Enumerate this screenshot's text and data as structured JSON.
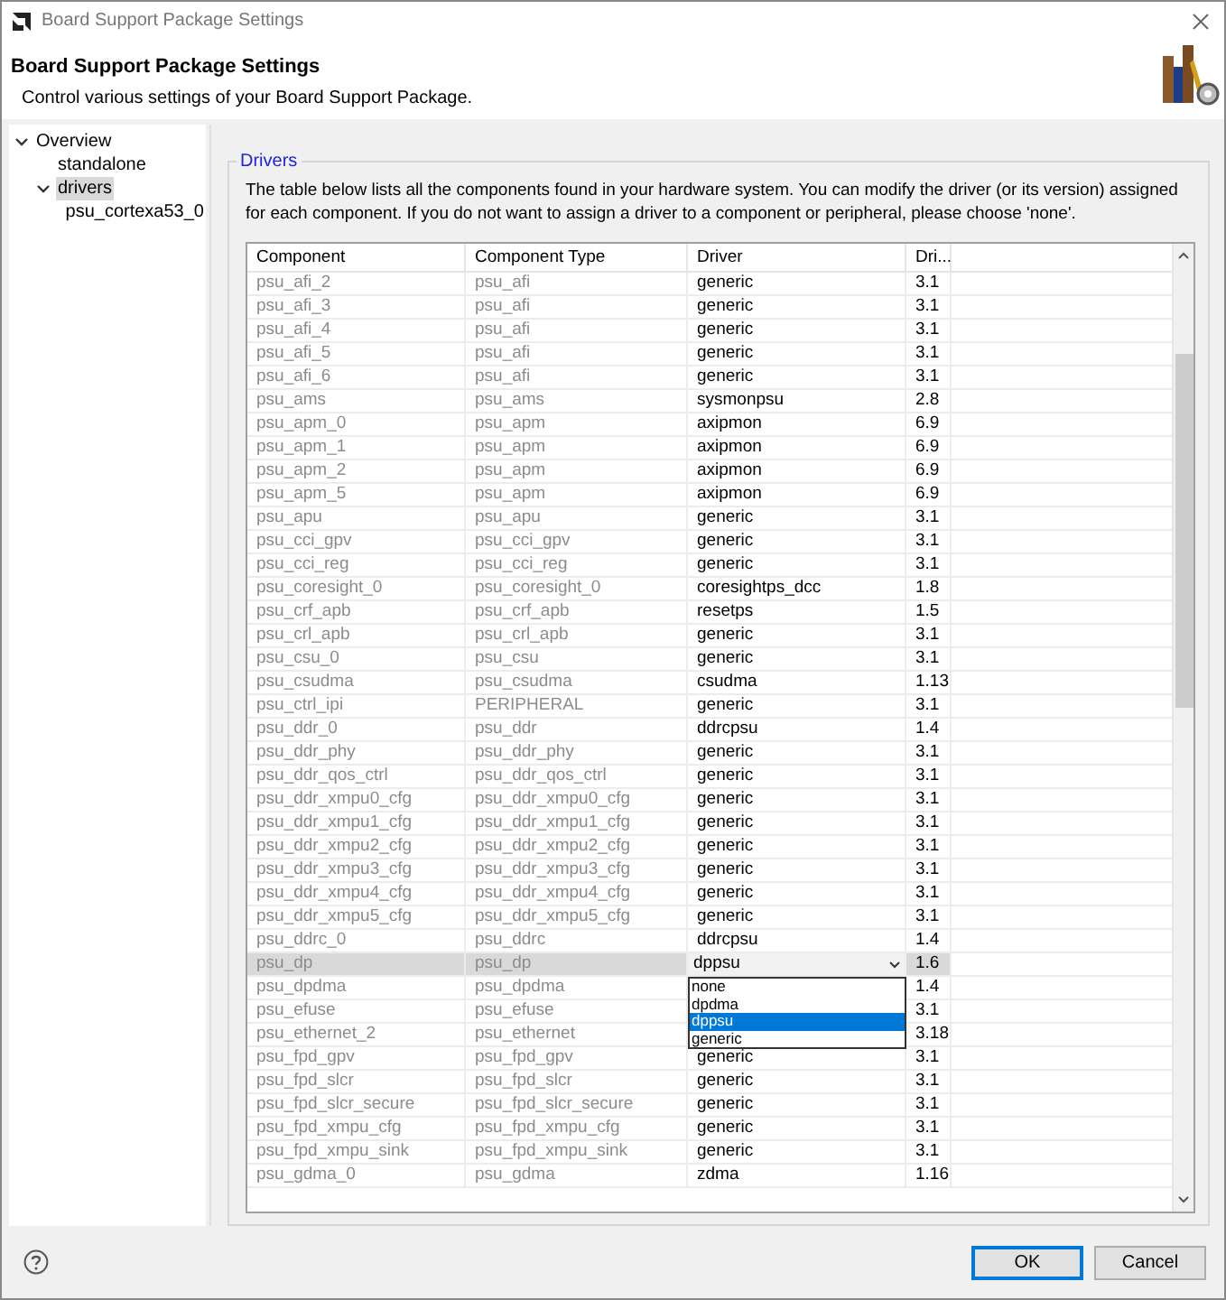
{
  "window": {
    "title": "Board Support Package Settings"
  },
  "header": {
    "title": "Board Support Package Settings",
    "subtitle": "Control various settings of your Board Support Package."
  },
  "tree": [
    {
      "label": "Overview",
      "expanded": true,
      "selected": false,
      "children": [
        {
          "label": "standalone",
          "selected": false
        },
        {
          "label": "drivers",
          "expanded": true,
          "selected": true,
          "children": [
            {
              "label": "psu_cortexa53_0",
              "selected": false
            }
          ]
        }
      ]
    }
  ],
  "group": {
    "title": "Drivers",
    "description": "The table below lists all the components found in your hardware system. You can modify the driver (or its version) assigned for each component. If you do not want to assign a driver to a component or peripheral, please choose 'none'."
  },
  "table": {
    "columns": [
      "Component",
      "Component Type",
      "Driver",
      "Dri..."
    ],
    "rows": [
      {
        "component": "psu_afi_2",
        "type": "psu_afi",
        "driver": "generic",
        "version": "3.1",
        "selected": false
      },
      {
        "component": "psu_afi_3",
        "type": "psu_afi",
        "driver": "generic",
        "version": "3.1",
        "selected": false
      },
      {
        "component": "psu_afi_4",
        "type": "psu_afi",
        "driver": "generic",
        "version": "3.1",
        "selected": false
      },
      {
        "component": "psu_afi_5",
        "type": "psu_afi",
        "driver": "generic",
        "version": "3.1",
        "selected": false
      },
      {
        "component": "psu_afi_6",
        "type": "psu_afi",
        "driver": "generic",
        "version": "3.1",
        "selected": false
      },
      {
        "component": "psu_ams",
        "type": "psu_ams",
        "driver": "sysmonpsu",
        "version": "2.8",
        "selected": false
      },
      {
        "component": "psu_apm_0",
        "type": "psu_apm",
        "driver": "axipmon",
        "version": "6.9",
        "selected": false
      },
      {
        "component": "psu_apm_1",
        "type": "psu_apm",
        "driver": "axipmon",
        "version": "6.9",
        "selected": false
      },
      {
        "component": "psu_apm_2",
        "type": "psu_apm",
        "driver": "axipmon",
        "version": "6.9",
        "selected": false
      },
      {
        "component": "psu_apm_5",
        "type": "psu_apm",
        "driver": "axipmon",
        "version": "6.9",
        "selected": false
      },
      {
        "component": "psu_apu",
        "type": "psu_apu",
        "driver": "generic",
        "version": "3.1",
        "selected": false
      },
      {
        "component": "psu_cci_gpv",
        "type": "psu_cci_gpv",
        "driver": "generic",
        "version": "3.1",
        "selected": false
      },
      {
        "component": "psu_cci_reg",
        "type": "psu_cci_reg",
        "driver": "generic",
        "version": "3.1",
        "selected": false
      },
      {
        "component": "psu_coresight_0",
        "type": "psu_coresight_0",
        "driver": "coresightps_dcc",
        "version": "1.8",
        "selected": false
      },
      {
        "component": "psu_crf_apb",
        "type": "psu_crf_apb",
        "driver": "resetps",
        "version": "1.5",
        "selected": false
      },
      {
        "component": "psu_crl_apb",
        "type": "psu_crl_apb",
        "driver": "generic",
        "version": "3.1",
        "selected": false
      },
      {
        "component": "psu_csu_0",
        "type": "psu_csu",
        "driver": "generic",
        "version": "3.1",
        "selected": false
      },
      {
        "component": "psu_csudma",
        "type": "psu_csudma",
        "driver": "csudma",
        "version": "1.13",
        "selected": false
      },
      {
        "component": "psu_ctrl_ipi",
        "type": "PERIPHERAL",
        "driver": "generic",
        "version": "3.1",
        "selected": false
      },
      {
        "component": "psu_ddr_0",
        "type": "psu_ddr",
        "driver": "ddrcpsu",
        "version": "1.4",
        "selected": false
      },
      {
        "component": "psu_ddr_phy",
        "type": "psu_ddr_phy",
        "driver": "generic",
        "version": "3.1",
        "selected": false
      },
      {
        "component": "psu_ddr_qos_ctrl",
        "type": "psu_ddr_qos_ctrl",
        "driver": "generic",
        "version": "3.1",
        "selected": false
      },
      {
        "component": "psu_ddr_xmpu0_cfg",
        "type": "psu_ddr_xmpu0_cfg",
        "driver": "generic",
        "version": "3.1",
        "selected": false
      },
      {
        "component": "psu_ddr_xmpu1_cfg",
        "type": "psu_ddr_xmpu1_cfg",
        "driver": "generic",
        "version": "3.1",
        "selected": false
      },
      {
        "component": "psu_ddr_xmpu2_cfg",
        "type": "psu_ddr_xmpu2_cfg",
        "driver": "generic",
        "version": "3.1",
        "selected": false
      },
      {
        "component": "psu_ddr_xmpu3_cfg",
        "type": "psu_ddr_xmpu3_cfg",
        "driver": "generic",
        "version": "3.1",
        "selected": false
      },
      {
        "component": "psu_ddr_xmpu4_cfg",
        "type": "psu_ddr_xmpu4_cfg",
        "driver": "generic",
        "version": "3.1",
        "selected": false
      },
      {
        "component": "psu_ddr_xmpu5_cfg",
        "type": "psu_ddr_xmpu5_cfg",
        "driver": "generic",
        "version": "3.1",
        "selected": false
      },
      {
        "component": "psu_ddrc_0",
        "type": "psu_ddrc",
        "driver": "ddrcpsu",
        "version": "1.4",
        "selected": false
      },
      {
        "component": "psu_dp",
        "type": "psu_dp",
        "driver": "dppsu",
        "version": "1.6",
        "selected": true,
        "dropdown": [
          {
            "label": "none",
            "selected": false
          },
          {
            "label": "dpdma",
            "selected": false
          },
          {
            "label": "dppsu",
            "selected": true
          },
          {
            "label": "generic",
            "selected": false
          }
        ]
      },
      {
        "component": "psu_dpdma",
        "type": "psu_dpdma",
        "version": "1.4",
        "selected": false
      },
      {
        "component": "psu_efuse",
        "type": "psu_efuse",
        "version": "3.1",
        "selected": false
      },
      {
        "component": "psu_ethernet_2",
        "type": "psu_ethernet",
        "version": "3.18",
        "selected": false
      },
      {
        "component": "psu_fpd_gpv",
        "type": "psu_fpd_gpv",
        "driver": "generic",
        "version": "3.1",
        "selected": false
      },
      {
        "component": "psu_fpd_slcr",
        "type": "psu_fpd_slcr",
        "driver": "generic",
        "version": "3.1",
        "selected": false
      },
      {
        "component": "psu_fpd_slcr_secure",
        "type": "psu_fpd_slcr_secure",
        "driver": "generic",
        "version": "3.1",
        "selected": false
      },
      {
        "component": "psu_fpd_xmpu_cfg",
        "type": "psu_fpd_xmpu_cfg",
        "driver": "generic",
        "version": "3.1",
        "selected": false
      },
      {
        "component": "psu_fpd_xmpu_sink",
        "type": "psu_fpd_xmpu_sink",
        "driver": "generic",
        "version": "3.1",
        "selected": false
      },
      {
        "component": "psu_gdma_0",
        "type": "psu_gdma",
        "driver": "zdma",
        "version": "1.16",
        "selected": false
      }
    ]
  },
  "buttons": [
    {
      "label": "OK",
      "kind": "default"
    },
    {
      "label": "Cancel",
      "kind": "normal"
    }
  ]
}
